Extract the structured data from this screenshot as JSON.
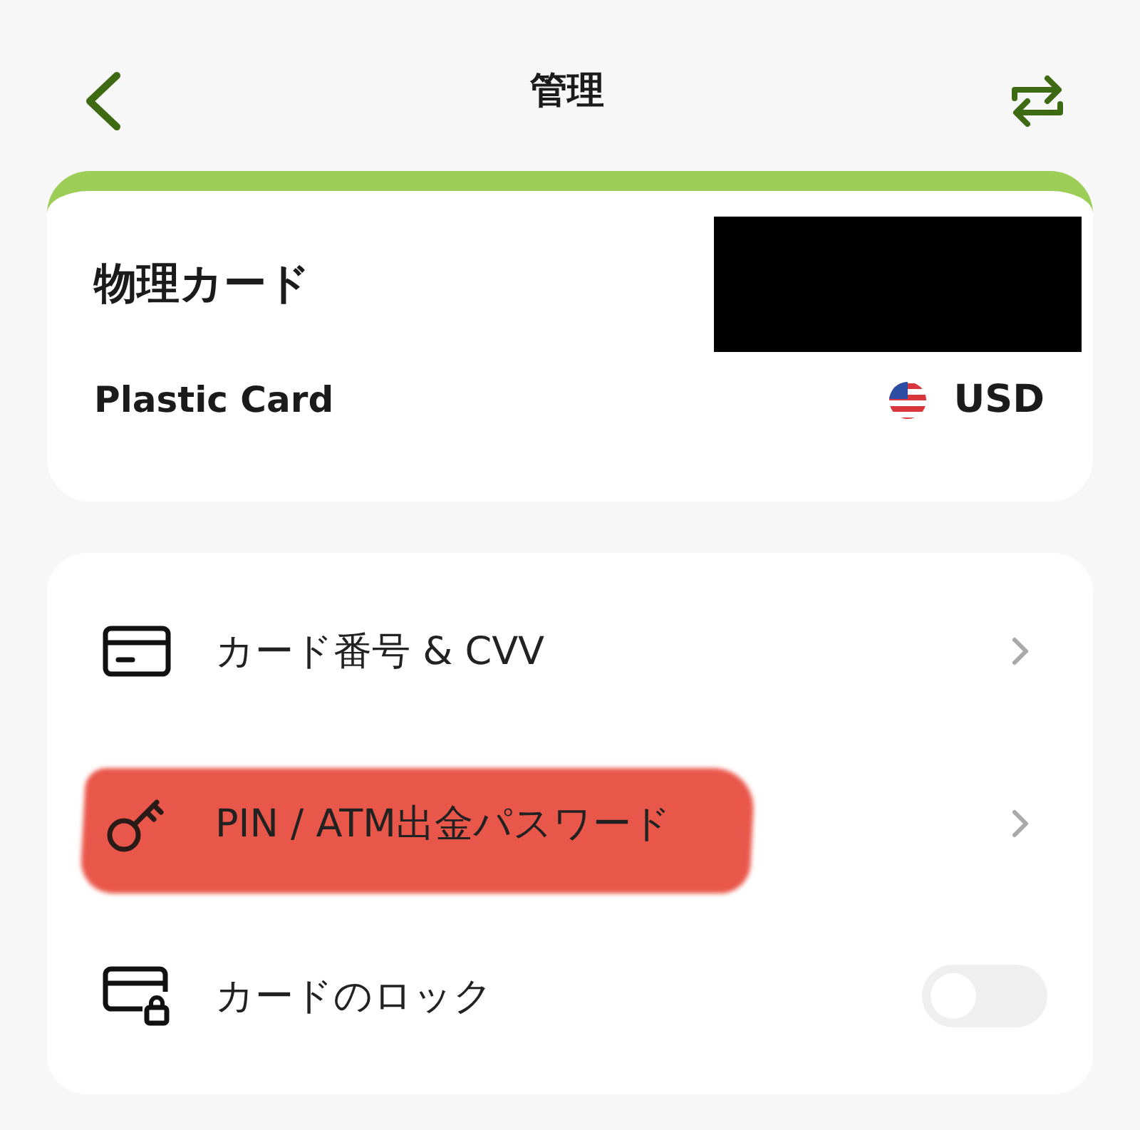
{
  "header": {
    "title": "管理"
  },
  "card": {
    "title": "物理カード",
    "type": "Plastic Card",
    "currency": "USD"
  },
  "menu": [
    {
      "kind": "link",
      "label": "カード番号 & CVV",
      "highlighted": false
    },
    {
      "kind": "link",
      "label": "PIN / ATM出金パスワード",
      "highlighted": true
    },
    {
      "kind": "toggle",
      "label": "カードのロック",
      "on": false,
      "highlighted": false
    }
  ]
}
